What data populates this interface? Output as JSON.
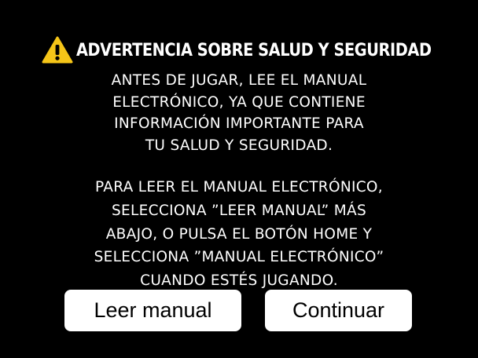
{
  "warning": {
    "icon": "warning-triangle-icon",
    "icon_color": "#F5C518",
    "title": "ADVERTENCIA SOBRE SALUD Y SEGURIDAD"
  },
  "paragraph1": {
    "lines": [
      "ANTES DE JUGAR, LEE EL MANUAL",
      "ELECTRÓNICO, YA QUE CONTIENE",
      "INFORMACIÓN IMPORTANTE PARA",
      "TU SALUD Y SEGURIDAD."
    ]
  },
  "paragraph2": {
    "lines": [
      "PARA LEER EL MANUAL ELECTRÓNICO,",
      "SELECCIONA ”LEER MANUAL” MÁS",
      "ABAJO, O PULSA EL BOTÓN HOME Y",
      "SELECCIONA  ”MANUAL ELECTRÓNICO”",
      "CUANDO ESTÉS JUGANDO."
    ]
  },
  "buttons": {
    "read_manual": "Leer manual",
    "continue": "Continuar"
  },
  "colors": {
    "background": "#000000",
    "text": "#FFFFFF",
    "button_background": "#FFFFFF",
    "button_text": "#000000"
  }
}
